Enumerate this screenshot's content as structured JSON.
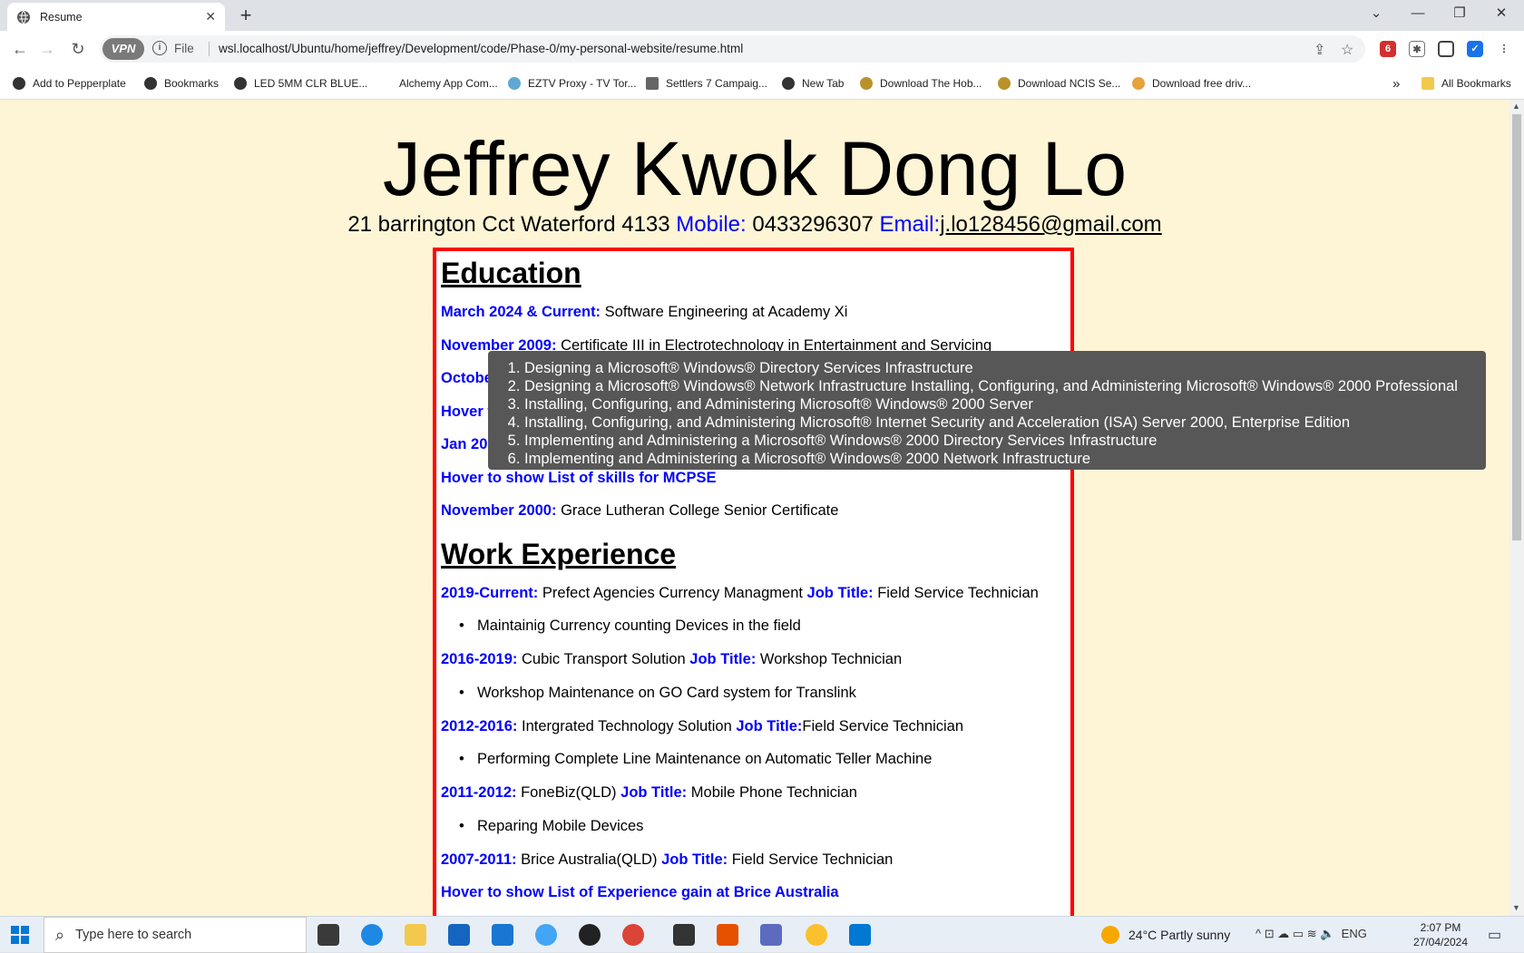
{
  "browser": {
    "tab_title": "Resume",
    "tab_close": "✕",
    "new_tab": "+",
    "file_label": "File",
    "url": "wsl.localhost/Ubuntu/home/jeffrey/Development/code/Phase-0/my-personal-website/resume.html",
    "vpn_label": "VPN"
  },
  "bookmarks": [
    "Add to Pepperplate",
    "Bookmarks",
    "LED 5MM CLR BLUE...",
    "Alchemy App Com...",
    "EZTV Proxy - TV Tor...",
    "Settlers 7 Campaig...",
    "New Tab",
    "Download The Hob...",
    "Download NCIS Se...",
    "Download free driv..."
  ],
  "bookmarks_more": "»",
  "all_bookmarks": "All Bookmarks",
  "resume": {
    "name": "Jeffrey Kwok Dong Lo",
    "address": "21 barrington Cct Waterford 4133",
    "mobile_label": "Mobile:",
    "mobile": "0433296307",
    "email_label": "Email:",
    "email": "j.lo128456@gmail.com",
    "education_heading": "Education",
    "education": [
      {
        "date": "March 2024 & Current:",
        "text": "Software Engineering at Academy Xi"
      },
      {
        "date": "November 2009:",
        "text": "Certificate III in Electrotechnology in Entertainment and Servicing"
      },
      {
        "date": "Octobe",
        "text": ""
      },
      {
        "date": "Hover t",
        "text": ""
      },
      {
        "date": "Jan 20",
        "text": ""
      }
    ],
    "mcpse_hover": "Hover to show List of skills for MCPSE",
    "school": {
      "date": "November 2000:",
      "text": "Grace Lutheran College Senior Certificate"
    },
    "work_heading": "Work Experience",
    "job_title_label": "Job Title:",
    "work": [
      {
        "date": "2019-Current:",
        "company": "Prefect Agencies Currency Managment",
        "title": "Field Service Technician",
        "bullet": "Maintainig Currency counting Devices in the field"
      },
      {
        "date": "2016-2019:",
        "company": "Cubic Transport Solution",
        "title": "Workshop Technician",
        "bullet": "Workshop Maintenance on GO Card system for Translink"
      },
      {
        "date": "2012-2016:",
        "company": "Intergrated Technology Solution",
        "title": "Field Service Technician",
        "bullet": "Performing Complete Line Maintenance on Automatic Teller Machine"
      },
      {
        "date": "2011-2012:",
        "company": "FoneBiz(QLD)",
        "title": "Mobile Phone Technician",
        "bullet": "Reparing Mobile Devices"
      },
      {
        "date": "2007-2011:",
        "company": "Brice Australia(QLD)",
        "title": "Field Service Technician",
        "bullet": ""
      }
    ],
    "brice_hover": "Hover to show List of Experience gain at Brice Australia"
  },
  "tooltip": [
    "Designing a Microsoft® Windows® Directory Services Infrastructure",
    "Designing a Microsoft® Windows® Network Infrastructure Installing, Configuring, and Administering Microsoft® Windows® 2000 Professional",
    "Installing, Configuring, and Administering Microsoft® Windows® 2000 Server",
    "Installing, Configuring, and Administering Microsoft® Internet Security and Acceleration (ISA) Server 2000, Enterprise Edition",
    "Implementing and Administering a Microsoft® Windows® 2000 Directory Services Infrastructure",
    "Implementing and Administering a Microsoft® Windows® 2000 Network Infrastructure"
  ],
  "taskbar": {
    "search_placeholder": "Type here to search",
    "weather": "24°C  Partly sunny",
    "lang": "ENG",
    "time": "2:07 PM",
    "date": "27/04/2024"
  }
}
